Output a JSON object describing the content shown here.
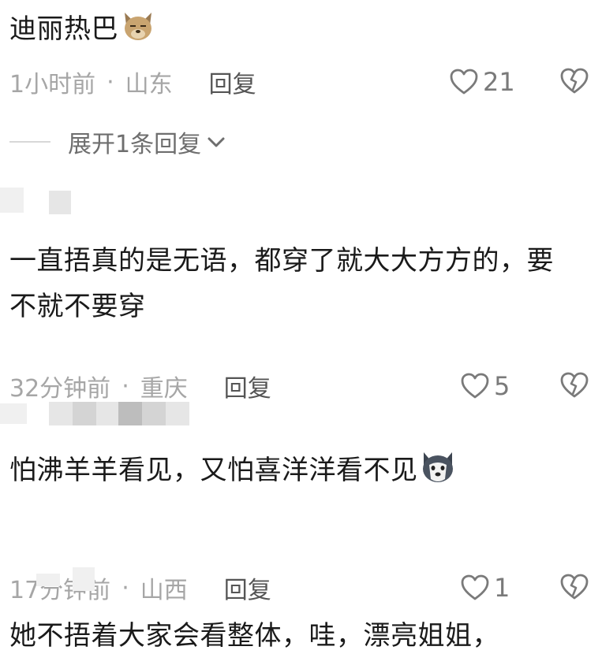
{
  "comments": [
    {
      "text": "迪丽热巴",
      "emoji": "dog-face-emoji",
      "time": "1小时前",
      "dot": "·",
      "location": "山东",
      "reply": "回复",
      "likes": "21"
    },
    {
      "text": "一直捂真的是无语，都穿了就大大方方的，要不就不要穿",
      "time": "32分钟前",
      "dot": "·",
      "location": "重庆",
      "reply": "回复",
      "likes": "5"
    },
    {
      "text": "怕沸羊羊看见，又怕喜洋洋看不见",
      "emoji": "husky-face-emoji",
      "time": "17分钟前",
      "dot": "·",
      "location": "山西",
      "reply": "回复",
      "likes": "1"
    },
    {
      "text": "她不捂着大家会看整体，哇，漂亮姐姐，"
    }
  ],
  "expand_replies": "展开1条回复",
  "colors": {
    "text": "#1a1a1a",
    "meta": "#a6a6a6",
    "reply": "#555555",
    "icon": "#7a7a7a"
  }
}
